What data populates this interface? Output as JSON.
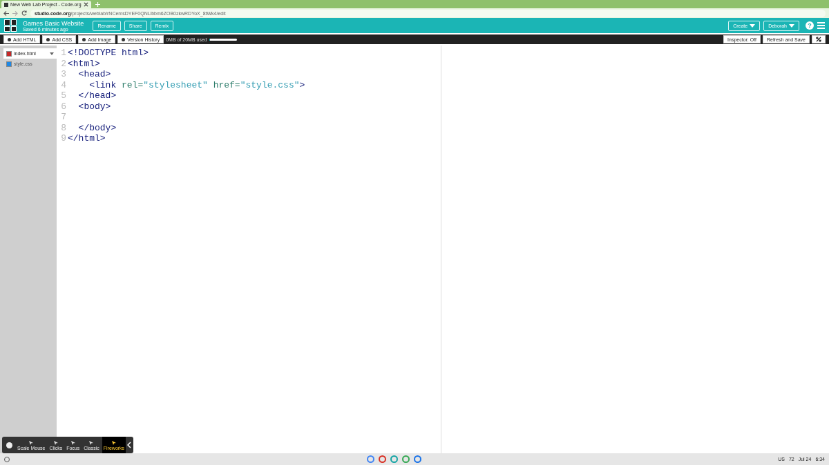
{
  "browser": {
    "tab_title": "New Web Lab Project - Code.org",
    "url_host": "studio.code.org",
    "url_path": "/projects/weblab/rNCemsDYEF0QNLlbbm6ZOB0zkwRDYoX_8tWk4/edit"
  },
  "header": {
    "project_name": "Games Basic Website",
    "saved": "Saved 6 minutes ago",
    "buttons": [
      "Rename",
      "Share",
      "Remix"
    ],
    "menus": [
      "Create",
      "Deborah"
    ],
    "help": "?"
  },
  "toolbar": {
    "buttons": [
      "Add HTML",
      "Add CSS",
      "Add Image",
      "Version History"
    ],
    "storage": "0MB of 20MB used",
    "level": 0.02,
    "right_buttons": [
      "Inspector: Off",
      "Refresh and Save"
    ]
  },
  "files": [
    {
      "name": "index.html",
      "kind": "html",
      "selected": true
    },
    {
      "name": "style.css",
      "kind": "css",
      "selected": false
    }
  ],
  "code": [
    {
      "number": "1",
      "tokens": [
        {
          "kind": "tag",
          "text": "<!DOCTYPE html>"
        }
      ]
    },
    {
      "number": "2",
      "tokens": [
        {
          "kind": "tag",
          "text": "<html>"
        }
      ]
    },
    {
      "number": "3",
      "tokens": [
        {
          "kind": "tag",
          "text": "  <head>"
        }
      ]
    },
    {
      "number": "4",
      "tokens": [
        {
          "kind": "tag",
          "text": "    <link "
        },
        {
          "kind": "attr",
          "text": "rel="
        },
        {
          "kind": "str",
          "text": "\"stylesheet\""
        },
        {
          "kind": "attr",
          "text": " href="
        },
        {
          "kind": "str",
          "text": "\"style.css\""
        },
        {
          "kind": "tag",
          "text": ">"
        }
      ]
    },
    {
      "number": "5",
      "tokens": [
        {
          "kind": "tag",
          "text": "  </head>"
        }
      ]
    },
    {
      "number": "6",
      "tokens": [
        {
          "kind": "tag",
          "text": "  <body>"
        }
      ]
    },
    {
      "number": "7"
    },
    {
      "number": "8",
      "tokens": [
        {
          "kind": "tag",
          "text": "  </body>"
        }
      ]
    },
    {
      "number": "9",
      "tokens": [
        {
          "kind": "tag",
          "text": "</html>"
        }
      ]
    }
  ],
  "recorder": {
    "tools": [
      {
        "label": "Scale Mouse",
        "selected": false
      },
      {
        "label": "Clicks",
        "selected": false
      },
      {
        "label": "Focus",
        "selected": false
      },
      {
        "label": "Classic",
        "selected": false
      },
      {
        "label": "Fireworks",
        "selected": true
      }
    ]
  },
  "taskbar": {
    "language": "US",
    "count": "72",
    "date": "Jul 24",
    "time": "6:34"
  }
}
